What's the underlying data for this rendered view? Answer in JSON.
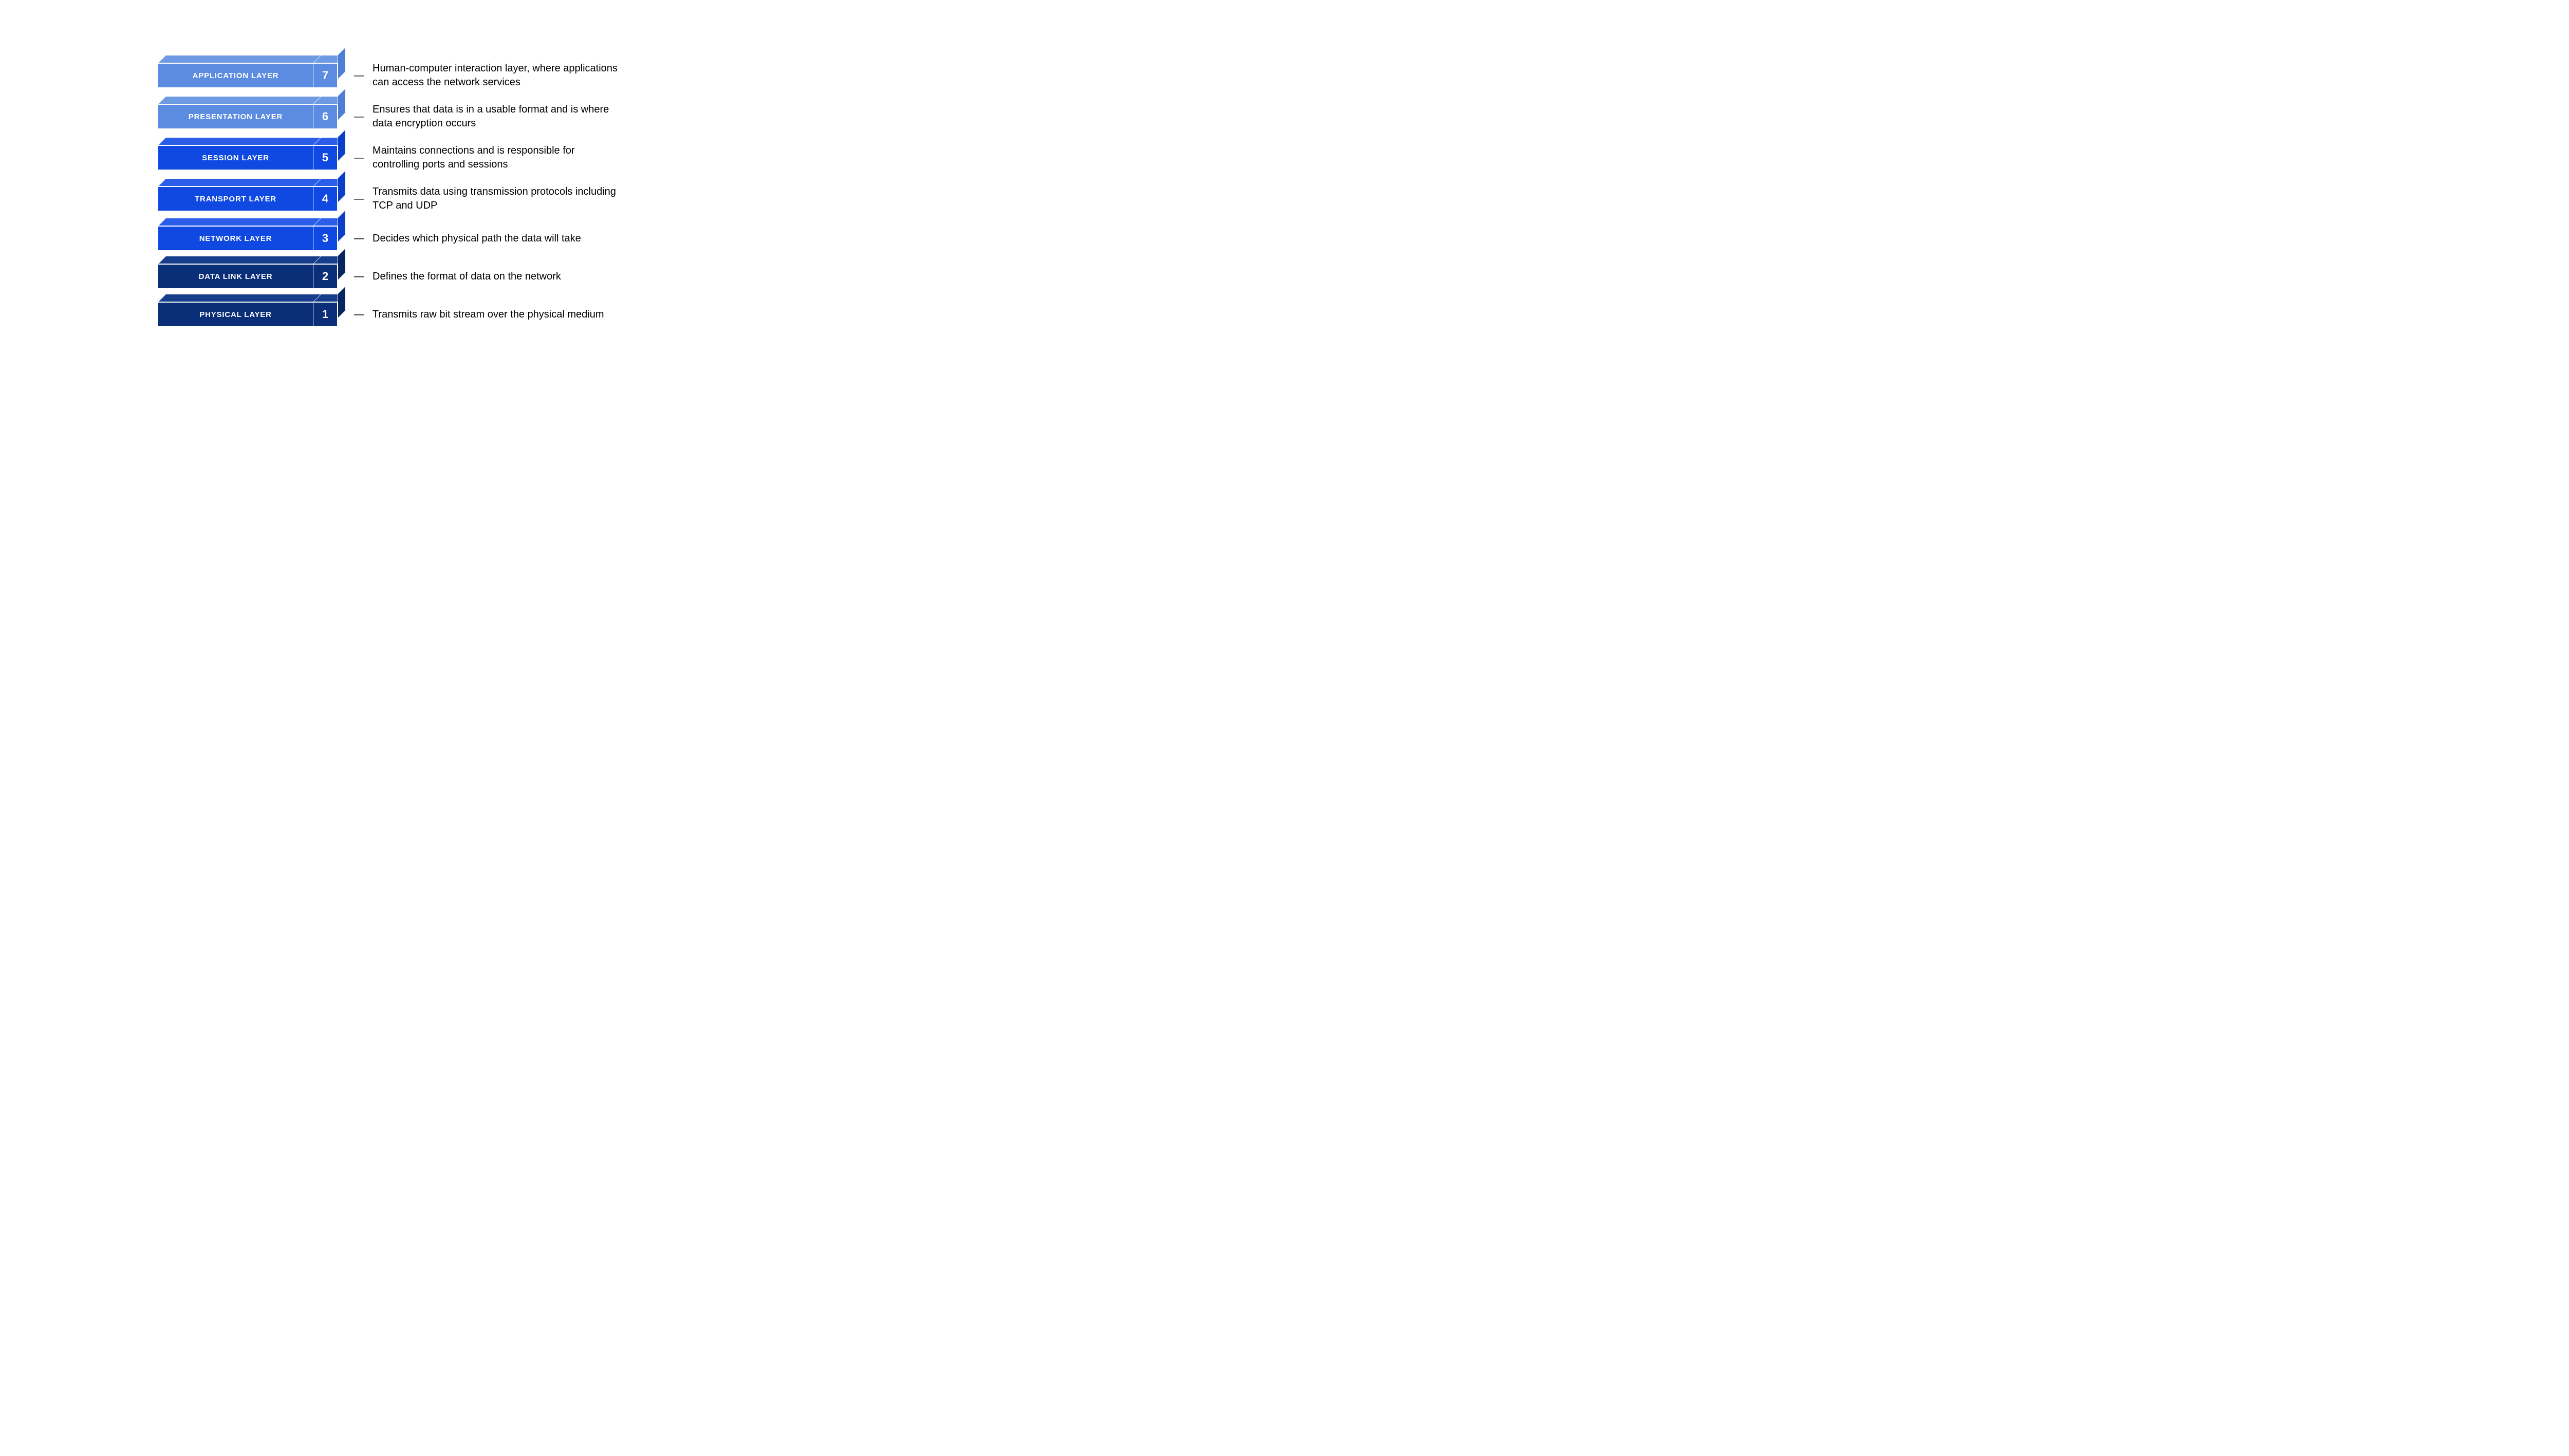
{
  "layers": [
    {
      "name": "APPLICATION LAYER",
      "number": "7",
      "description": "Human-computer interaction layer, where applications can access the network services",
      "front": "#5b8ce1",
      "top": "#6e9ae4",
      "side": "#4e7fd4"
    },
    {
      "name": "PRESENTATION LAYER",
      "number": "6",
      "description": "Ensures that data is in a usable format and is where data encryption occurs",
      "front": "#5b8ce1",
      "top": "#6e9ae4",
      "side": "#4e7fd4"
    },
    {
      "name": "SESSION LAYER",
      "number": "5",
      "description": "Maintains connections and is responsible for controlling ports and sessions",
      "front": "#0f49e2",
      "top": "#2a5ee8",
      "side": "#0c3fc9"
    },
    {
      "name": "TRANSPORT LAYER",
      "number": "4",
      "description": "Transmits data using transmission protocols including TCP and UDP",
      "front": "#0f49e2",
      "top": "#2a5ee8",
      "side": "#0c3fc9"
    },
    {
      "name": "NETWORK LAYER",
      "number": "3",
      "description": "Decides which physical path the data will take",
      "front": "#0f49e2",
      "top": "#2a5ee8",
      "side": "#0c3fc9"
    },
    {
      "name": "DATA LINK LAYER",
      "number": "2",
      "description": "Defines the format of data on the network",
      "front": "#0a2e78",
      "top": "#163c8c",
      "side": "#082560"
    },
    {
      "name": "PHYSICAL LAYER",
      "number": "1",
      "description": "Transmits raw bit stream over the physical medium",
      "front": "#0a2e78",
      "top": "#163c8c",
      "side": "#082560"
    }
  ],
  "dash": "—"
}
